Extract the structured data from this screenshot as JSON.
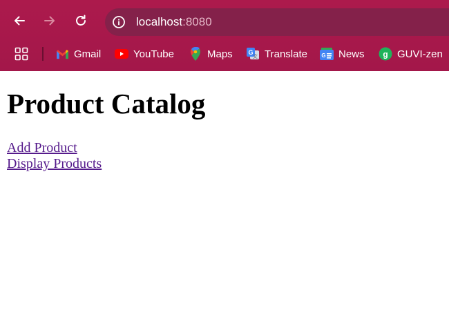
{
  "browser": {
    "url_host": "localhost",
    "url_port": ":8080",
    "colors": {
      "frame": "#a51849",
      "omnibox": "#84214a"
    },
    "bookmarks": [
      {
        "label": "Gmail",
        "icon": "gmail-icon"
      },
      {
        "label": "YouTube",
        "icon": "youtube-icon"
      },
      {
        "label": "Maps",
        "icon": "maps-icon"
      },
      {
        "label": "Translate",
        "icon": "translate-icon"
      },
      {
        "label": "News",
        "icon": "news-icon"
      },
      {
        "label": "GUVI-zen",
        "icon": "guvi-icon"
      }
    ]
  },
  "page": {
    "title": "Product Catalog",
    "links": [
      {
        "label": "Add Product"
      },
      {
        "label": "Display Products"
      }
    ],
    "link_color": "#551a8b"
  }
}
